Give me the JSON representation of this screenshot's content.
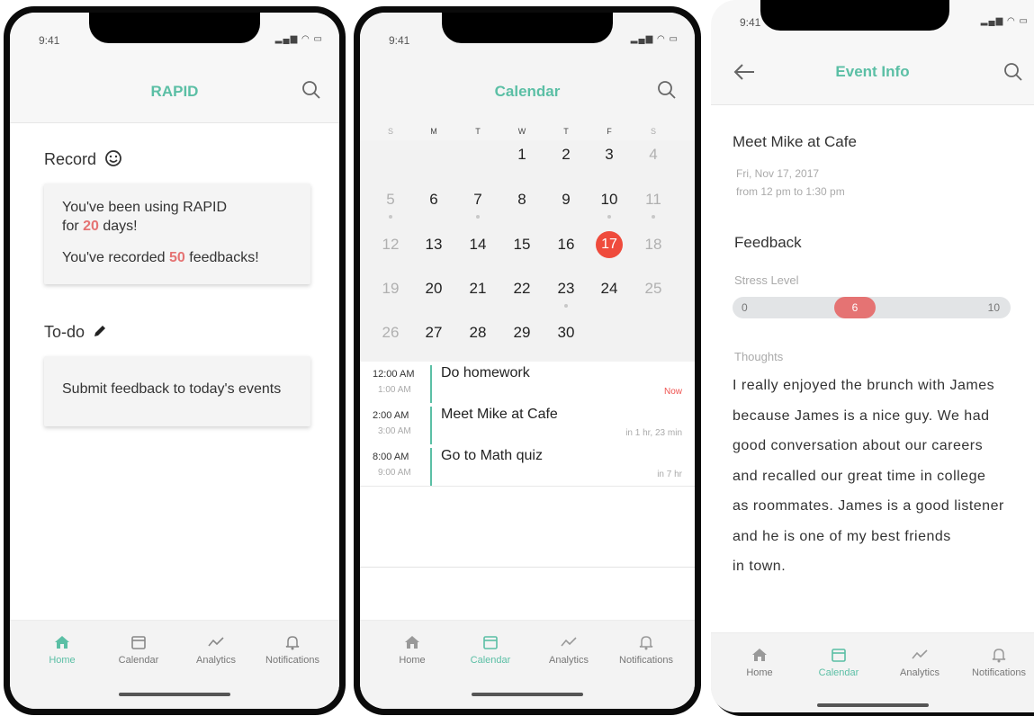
{
  "colors": {
    "accent": "#5bbfa5",
    "highlight": "#e57373",
    "today": "#ef4b3c"
  },
  "status": {
    "time": "9:41"
  },
  "tabs": [
    {
      "label": "Home",
      "icon": "home-icon"
    },
    {
      "label": "Calendar",
      "icon": "calendar-icon"
    },
    {
      "label": "Analytics",
      "icon": "analytics-icon"
    },
    {
      "label": "Notifications",
      "icon": "bell-icon"
    }
  ],
  "home": {
    "title": "RAPID",
    "record_title": "Record",
    "record_line1": "You've been using RAPID",
    "record_for": "for",
    "record_days_num": "20",
    "record_days": "days!",
    "record_prefix": "You've recorded",
    "record_count": "50",
    "record_suffix": "feedbacks!",
    "todo_title": "To-do",
    "todo_item": "Submit feedback to today's events"
  },
  "calendar": {
    "title": "Calendar",
    "weekdays": [
      "S",
      "M",
      "T",
      "W",
      "T",
      "F",
      "S"
    ],
    "weeks": [
      [
        "",
        "",
        "",
        "1",
        "2",
        "3",
        "4"
      ],
      [
        "5",
        "6",
        "7",
        "8",
        "9",
        "10",
        "11"
      ],
      [
        "12",
        "13",
        "14",
        "15",
        "16",
        "17",
        "18"
      ],
      [
        "19",
        "20",
        "21",
        "22",
        "23",
        "24",
        "25"
      ],
      [
        "26",
        "27",
        "28",
        "29",
        "30",
        "",
        ""
      ]
    ],
    "today": "17",
    "events": [
      {
        "start": "12:00 AM",
        "end": "1:00 AM",
        "title": "Do homework",
        "relative": "Now"
      },
      {
        "start": "2:00 AM",
        "end": "3:00 AM",
        "title": "Meet Mike at Cafe",
        "relative": "in 1 hr, 23 min"
      },
      {
        "start": "8:00 AM",
        "end": "9:00 AM",
        "title": "Go to Math quiz",
        "relative": "in 7 hr"
      }
    ]
  },
  "event_info": {
    "title": "Event Info",
    "event_name": "Meet Mike at Cafe",
    "date": "Fri, Nov 17, 2017",
    "time_range": "from 12 pm to 1:30 pm",
    "feedback_title": "Feedback",
    "stress_label": "Stress Level",
    "stress_min": "0",
    "stress_value": "6",
    "stress_max": "10",
    "thoughts_label": "Thoughts",
    "thoughts_lines": [
      "I really enjoyed the brunch with James",
      "because James is a nice guy. We had",
      "good conversation about our careers",
      "and recalled our great time in college",
      "as roommates. James is a good listener",
      "and he is one of my best friends",
      "in town."
    ]
  }
}
